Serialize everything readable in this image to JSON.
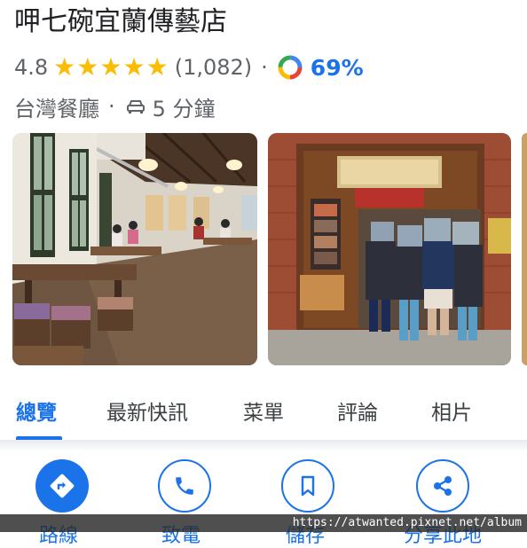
{
  "place": {
    "name": "呷七碗宜蘭傳藝店",
    "rating": "4.8",
    "stars": 5,
    "review_count": "(1,082)",
    "rating_sep": "·",
    "google_score": "69%",
    "category": "台灣餐廳",
    "category_sep": "·",
    "drive_time": "5 分鐘"
  },
  "icons": {
    "star": "star-icon",
    "google": "google-logo-icon",
    "car": "car-icon",
    "directions": "directions-icon",
    "phone": "phone-icon",
    "bookmark": "bookmark-icon",
    "share": "share-icon"
  },
  "tabs": [
    {
      "label": "總覽",
      "active": true
    },
    {
      "label": "最新快訊",
      "active": false
    },
    {
      "label": "菜單",
      "active": false
    },
    {
      "label": "評論",
      "active": false
    },
    {
      "label": "相片",
      "active": false
    }
  ],
  "actions": [
    {
      "label": "路線"
    },
    {
      "label": "致電"
    },
    {
      "label": "儲存"
    },
    {
      "label": "分享此地"
    }
  ],
  "watermark": "https://atwanted.pixnet.net/album",
  "colors": {
    "accent": "#1a73e8",
    "star": "#fbbc04",
    "text_secondary": "#5f6368"
  }
}
